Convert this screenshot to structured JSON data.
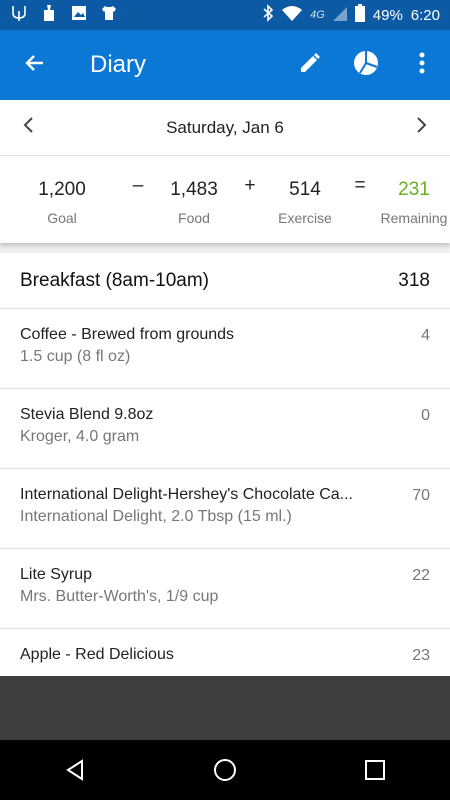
{
  "status": {
    "network": "4G",
    "battery": "49%",
    "time": "6:20"
  },
  "app_bar": {
    "title": "Diary"
  },
  "date_nav": {
    "date": "Saturday, Jan 6"
  },
  "summary": {
    "goal": "1,200",
    "goal_label": "Goal",
    "minus": "–",
    "food": "1,483",
    "food_label": "Food",
    "plus": "+",
    "exercise": "514",
    "exercise_label": "Exercise",
    "equals": "=",
    "remaining": "231",
    "remaining_label": "Remaining"
  },
  "meal": {
    "name": "Breakfast (8am-10am)",
    "calories": "318",
    "entries": [
      {
        "name": "Coffee - Brewed from grounds",
        "desc": "1.5 cup (8 fl oz)",
        "cal": "4"
      },
      {
        "name": "Stevia Blend 9.8oz",
        "desc": "Kroger, 4.0 gram",
        "cal": "0"
      },
      {
        "name": "International Delight-Hershey's Chocolate Ca...",
        "desc": "International Delight, 2.0 Tbsp (15 ml.)",
        "cal": "70"
      },
      {
        "name": "Lite Syrup",
        "desc": "Mrs. Butter-Worth's,  1/9 cup",
        "cal": "22"
      },
      {
        "name": "Apple - Red Delicious",
        "desc": "",
        "cal": "23"
      }
    ]
  },
  "colors": {
    "status_bar": "#0b5aa3",
    "app_bar": "#0a78d4",
    "remaining_green": "#6aaf1f"
  },
  "icons": {
    "back": "arrow-left-icon",
    "edit": "pencil-icon",
    "chart": "pie-chart-icon",
    "menu": "more-vert-icon"
  }
}
